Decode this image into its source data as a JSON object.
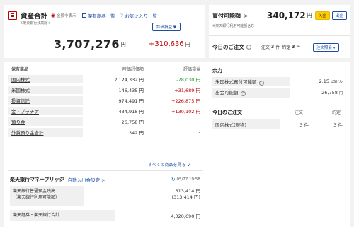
{
  "assets": {
    "title": "資産合計",
    "hide_amount_label": "金額非表示",
    "note": "※楽天銀行残高除く",
    "holdings_link": "保有商品一覧",
    "favorites_link": "お気に入り一覧",
    "valuation_button": "評価損益 ▼",
    "total": "3,707,276",
    "unit": "円",
    "diff": "+310,636",
    "diff_unit": "円"
  },
  "buying_power": {
    "title": "買付可能額",
    "amount": "340,172",
    "unit": "円",
    "note": "※楽天銀行利用可能額含む",
    "deposit_button": "入金",
    "withdraw_button": "出金",
    "orders_title": "今日のご注文",
    "orders_summary": "注文 3 件 約定 3 件",
    "orders_summary_a": "注文",
    "orders_count": "3",
    "orders_unit": "件",
    "executed_label": "約定",
    "executed_count": "3",
    "executed_unit": "件",
    "orders_inquiry_button": "注文照会 ▾"
  },
  "holdings": {
    "section_title": "保有商品",
    "col_value": "時価評価額",
    "col_pl": "評価損益",
    "rows": [
      {
        "name": "国内株式",
        "value": "2,124,332",
        "unit": "円",
        "pl": "-78,030",
        "pl_unit": "円",
        "pl_color": "#19922e"
      },
      {
        "name": "米国株式",
        "value": "146,435",
        "unit": "円",
        "pl": "+31,689",
        "pl_unit": "円",
        "pl_color": "#bf0000"
      },
      {
        "name": "投資信託",
        "value": "974,491",
        "unit": "円",
        "pl": "+226,875",
        "pl_unit": "円",
        "pl_color": "#bf0000"
      },
      {
        "name": "金・プラチナ",
        "value": "434,918",
        "unit": "円",
        "pl": "+130,102",
        "pl_unit": "円",
        "pl_color": "#bf0000"
      },
      {
        "name": "預り金",
        "value": "26,758",
        "unit": "円",
        "pl": "-",
        "pl_unit": "",
        "pl_color": "#333333"
      },
      {
        "name": "外貨預り金合計",
        "value": "342",
        "unit": "円",
        "pl": "-",
        "pl_unit": "",
        "pl_color": "#333333"
      }
    ],
    "show_all_link": "すべての商品を見る ∨"
  },
  "bank": {
    "title": "楽天銀行マネーブリッジ",
    "settings_link": "自動入出金設定 >",
    "timestamp": "05/27 19:58",
    "row1_label_line1": "楽天銀行普通預金残高",
    "row1_label_line2": "（楽天銀行利用可能額）",
    "row1_value1": "313,414",
    "row1_value2": "(313,414",
    "unit": "円",
    "unit_paren": "円)",
    "row2_label": "楽天証券・楽天銀行合計",
    "row2_value": "4,020,690"
  },
  "power": {
    "section_title": "余力",
    "rows": [
      {
        "name": "米国株式買付可能額",
        "value": "2.15",
        "unit": "USドル"
      },
      {
        "name": "出金可能額",
        "value": "26,758",
        "unit": "円"
      }
    ]
  },
  "today_orders": {
    "section_title": "今日のご注文",
    "col_order": "注文",
    "col_executed": "約定",
    "rows": [
      {
        "name": "国内株式(現物)",
        "orders": "3",
        "executed": "3",
        "unit": "件"
      }
    ]
  }
}
